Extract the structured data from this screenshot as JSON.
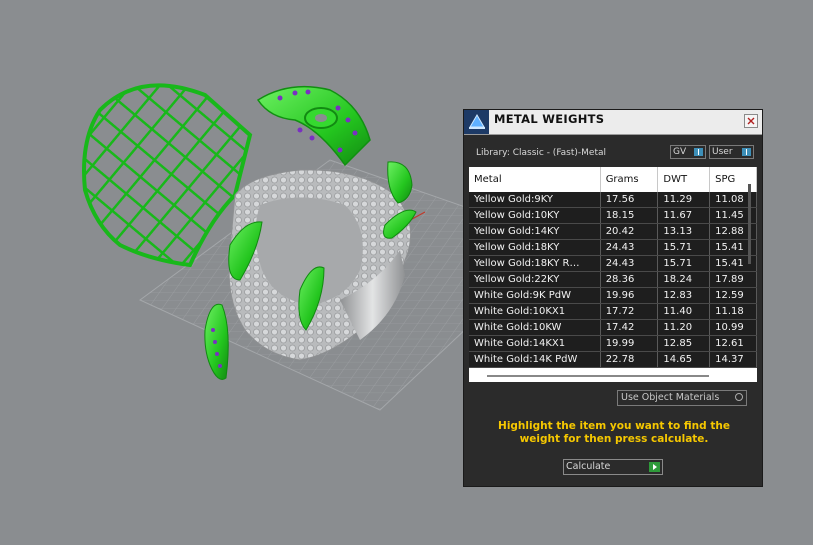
{
  "panel": {
    "title": "METAL WEIGHTS",
    "library_label": "Library: Classic - (Fast)-Metal",
    "toggles": [
      "GV",
      "User"
    ],
    "columns": [
      "Metal",
      "Grams",
      "DWT",
      "SPG"
    ],
    "rows": [
      [
        "Yellow Gold:9KY",
        "17.56",
        "11.29",
        "11.08"
      ],
      [
        "Yellow Gold:10KY",
        "18.15",
        "11.67",
        "11.45"
      ],
      [
        "Yellow Gold:14KY",
        "20.42",
        "13.13",
        "12.88"
      ],
      [
        "Yellow Gold:18KY",
        "24.43",
        "15.71",
        "15.41"
      ],
      [
        "Yellow Gold:18KY R…",
        "24.43",
        "15.71",
        "15.41"
      ],
      [
        "Yellow Gold:22KY",
        "28.36",
        "18.24",
        "17.89"
      ],
      [
        "White Gold:9K PdW",
        "19.96",
        "12.83",
        "12.59"
      ],
      [
        "White Gold:10KX1",
        "17.72",
        "11.40",
        "11.18"
      ],
      [
        "White Gold:10KW",
        "17.42",
        "11.20",
        "10.99"
      ],
      [
        "White Gold:14KX1",
        "19.99",
        "12.85",
        "12.61"
      ],
      [
        "White Gold:14K PdW",
        "22.78",
        "14.65",
        "14.37"
      ]
    ],
    "use_object_materials": "Use Object Materials",
    "hint": "Highlight the item you want to find the weight for then press calculate.",
    "calculate_label": "Calculate"
  },
  "colors": {
    "viewport_bg": "#8a8d90",
    "model_green": "#2fd12a",
    "hint_yellow": "#f6c800"
  },
  "icons": {
    "logo": "metal-weights-logo-icon",
    "close": "close-icon",
    "go": "play-arrow-icon"
  }
}
